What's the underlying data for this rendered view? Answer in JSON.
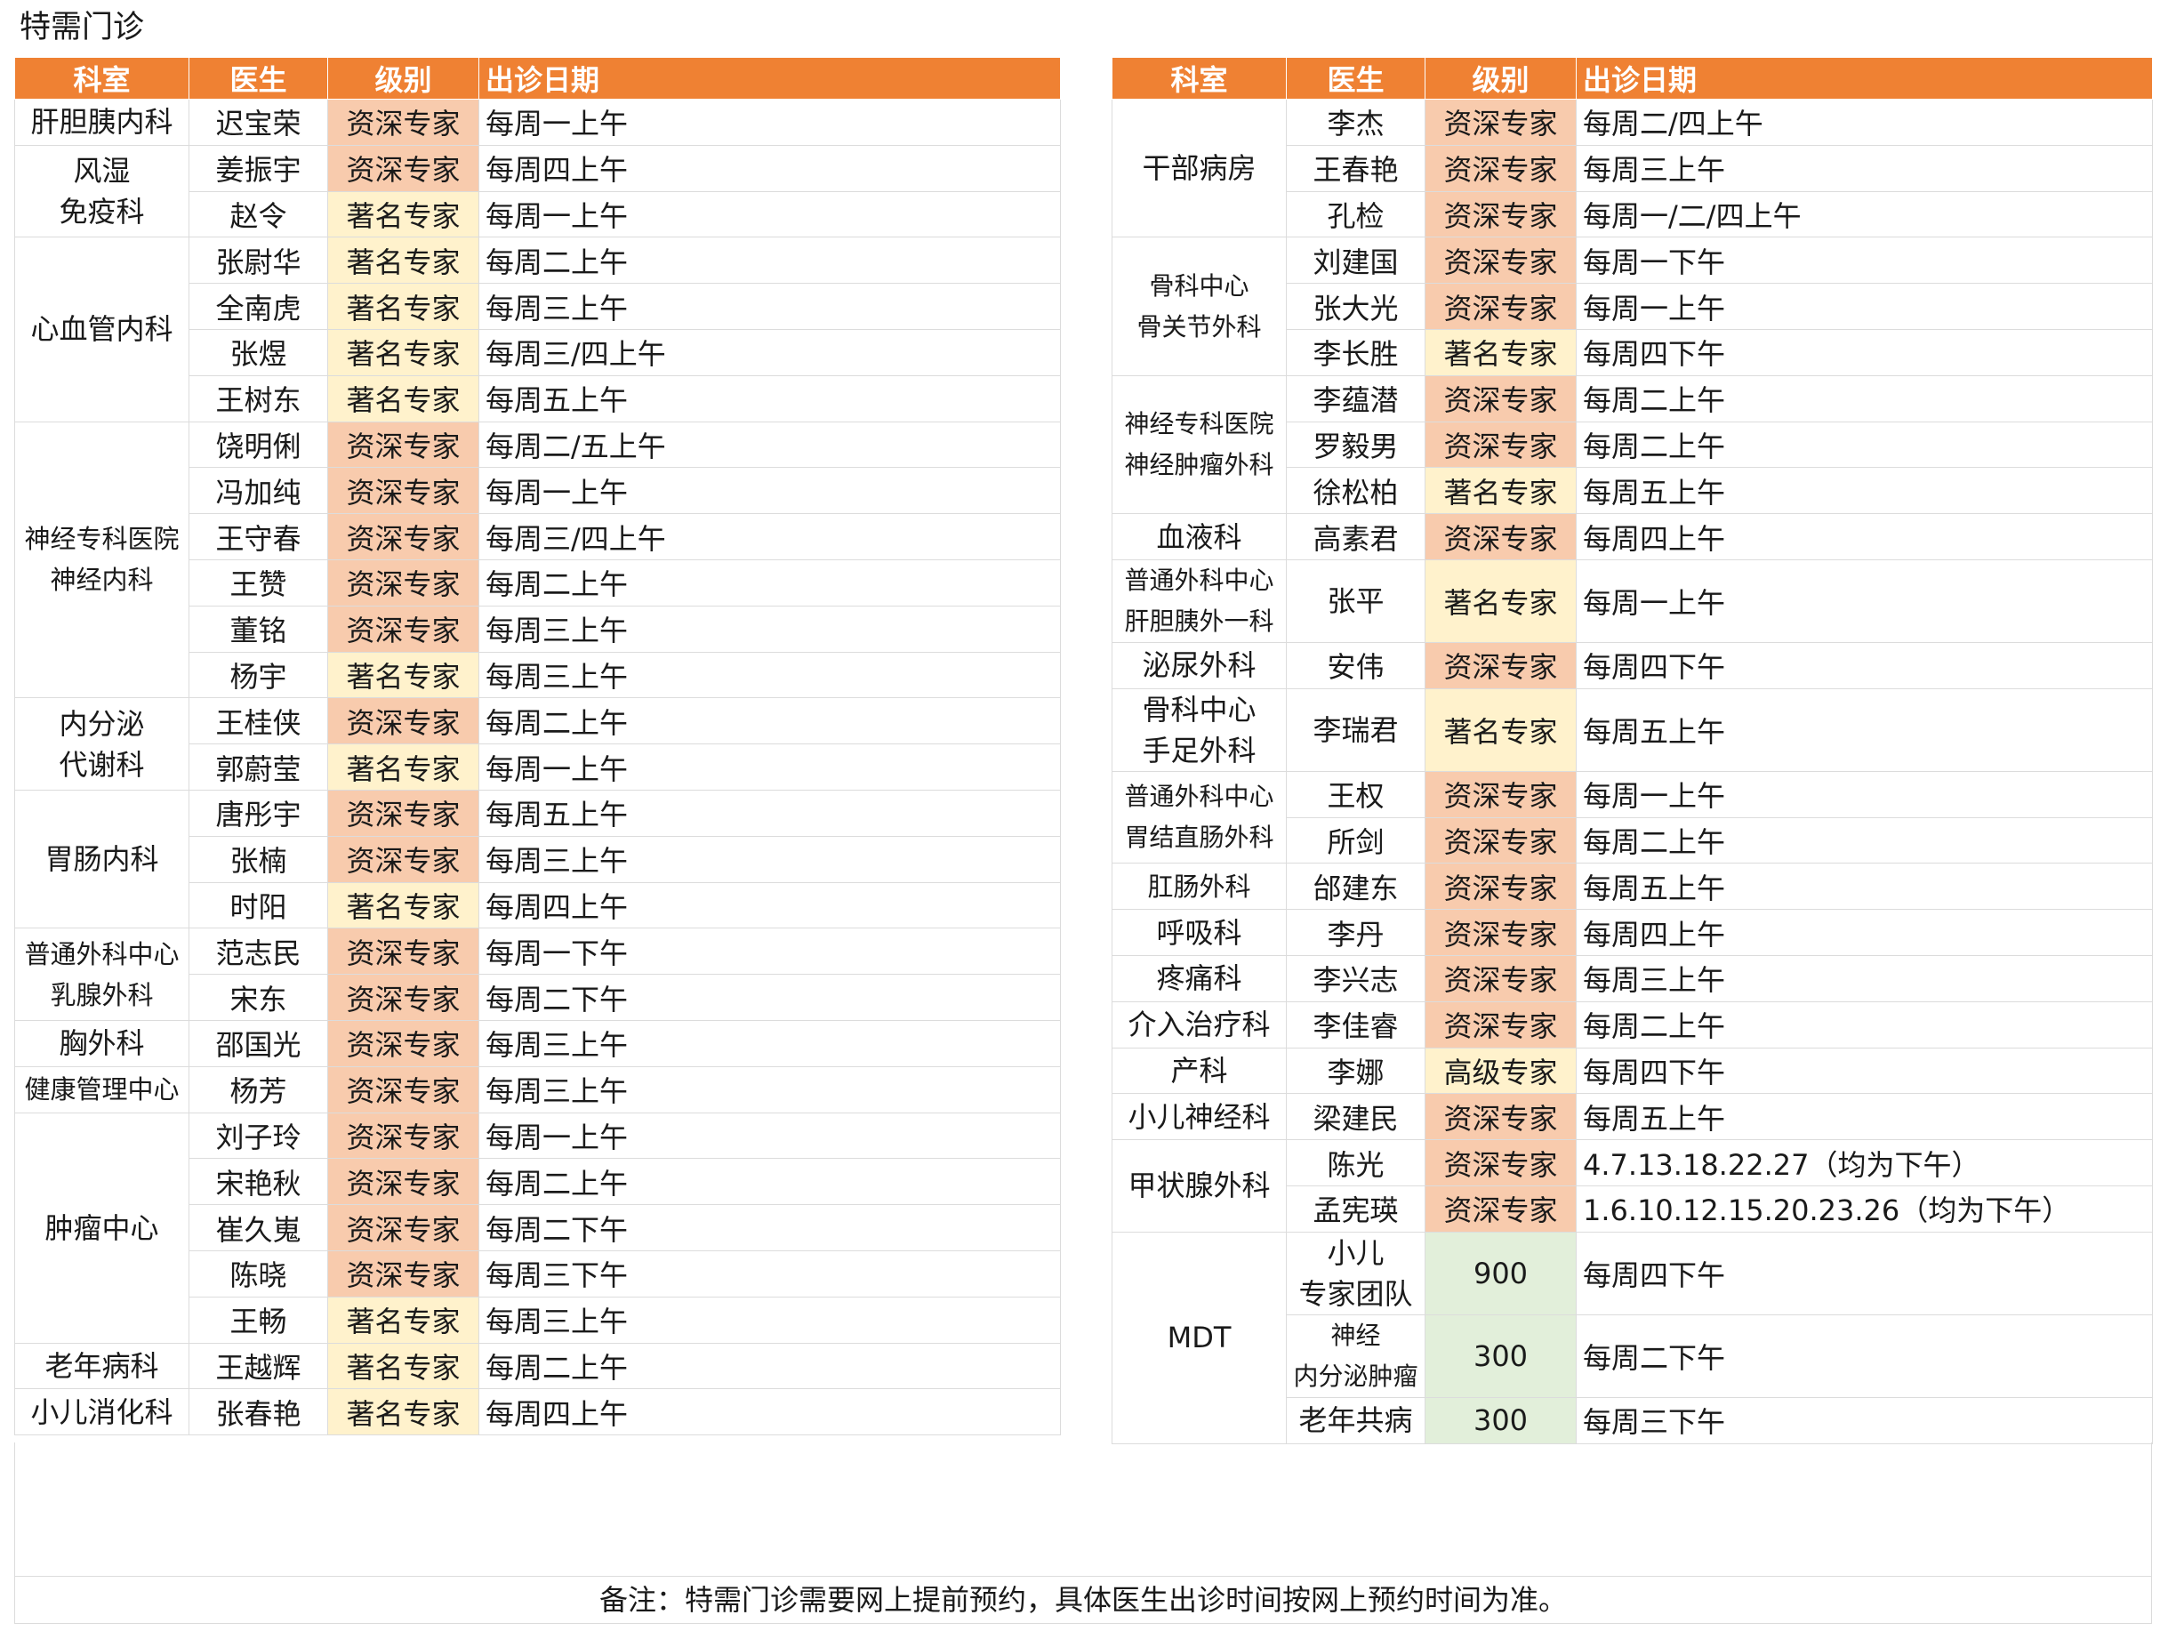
{
  "title": "特需门诊",
  "headers": [
    "科室",
    "医生",
    "级别",
    "出诊日期"
  ],
  "left_rows": [
    {
      "dept": "肝胆胰内科",
      "span": 1,
      "doctor": "迟宝荣",
      "level": "资深专家",
      "lvl": "zishen",
      "date": "每周一上午"
    },
    {
      "dept": "风湿\n免疫科",
      "span": 2,
      "doctor": "姜振宇",
      "level": "资深专家",
      "lvl": "zishen",
      "date": "每周四上午"
    },
    {
      "doctor": "赵令",
      "level": "著名专家",
      "lvl": "zhuming",
      "date": "每周一上午"
    },
    {
      "dept": "心血管内科",
      "span": 4,
      "doctor": "张尉华",
      "level": "著名专家",
      "lvl": "zhuming",
      "date": "每周二上午"
    },
    {
      "doctor": "全南虎",
      "level": "著名专家",
      "lvl": "zhuming",
      "date": "每周三上午"
    },
    {
      "doctor": "张煜",
      "level": "著名专家",
      "lvl": "zhuming",
      "date": "每周三/四上午"
    },
    {
      "doctor": "王树东",
      "level": "著名专家",
      "lvl": "zhuming",
      "date": "每周五上午"
    },
    {
      "dept": "神经专科医院\n神经内科",
      "span": 6,
      "sz": "sm",
      "doctor": "饶明俐",
      "level": "资深专家",
      "lvl": "zishen",
      "date": "每周二/五上午"
    },
    {
      "doctor": "冯加纯",
      "level": "资深专家",
      "lvl": "zishen",
      "date": "每周一上午"
    },
    {
      "doctor": "王守春",
      "level": "资深专家",
      "lvl": "zishen",
      "date": "每周三/四上午"
    },
    {
      "doctor": "王赞",
      "level": "资深专家",
      "lvl": "zishen",
      "date": "每周二上午"
    },
    {
      "doctor": "董铭",
      "level": "资深专家",
      "lvl": "zishen",
      "date": "每周三上午"
    },
    {
      "doctor": "杨宇",
      "level": "著名专家",
      "lvl": "zhuming",
      "date": "每周三上午"
    },
    {
      "dept": "内分泌\n代谢科",
      "span": 2,
      "doctor": "王桂侠",
      "level": "资深专家",
      "lvl": "zishen",
      "date": "每周二上午"
    },
    {
      "doctor": "郭蔚莹",
      "level": "著名专家",
      "lvl": "zhuming",
      "date": "每周一上午"
    },
    {
      "dept": "胃肠内科",
      "span": 3,
      "doctor": "唐彤宇",
      "level": "资深专家",
      "lvl": "zishen",
      "date": "每周五上午"
    },
    {
      "doctor": "张楠",
      "level": "资深专家",
      "lvl": "zishen",
      "date": "每周三上午"
    },
    {
      "doctor": "时阳",
      "level": "著名专家",
      "lvl": "zhuming",
      "date": "每周四上午"
    },
    {
      "dept": "普通外科中心\n乳腺外科",
      "span": 2,
      "sz": "sm",
      "doctor": "范志民",
      "level": "资深专家",
      "lvl": "zishen",
      "date": "每周一下午"
    },
    {
      "doctor": "宋东",
      "level": "资深专家",
      "lvl": "zishen",
      "date": "每周二下午"
    },
    {
      "dept": "胸外科",
      "span": 1,
      "doctor": "邵国光",
      "level": "资深专家",
      "lvl": "zishen",
      "date": "每周三上午"
    },
    {
      "dept": "健康管理中心",
      "span": 1,
      "sz": "sm",
      "doctor": "杨芳",
      "level": "资深专家",
      "lvl": "zishen",
      "date": "每周三上午"
    },
    {
      "dept": "肿瘤中心",
      "span": 5,
      "doctor": "刘子玲",
      "level": "资深专家",
      "lvl": "zishen",
      "date": "每周一上午"
    },
    {
      "doctor": "宋艳秋",
      "level": "资深专家",
      "lvl": "zishen",
      "date": "每周二上午"
    },
    {
      "doctor": "崔久嵬",
      "level": "资深专家",
      "lvl": "zishen",
      "date": "每周二下午"
    },
    {
      "doctor": "陈晓",
      "level": "资深专家",
      "lvl": "zishen",
      "date": "每周三下午"
    },
    {
      "doctor": "王畅",
      "level": "著名专家",
      "lvl": "zhuming",
      "date": "每周三上午"
    },
    {
      "dept": "老年病科",
      "span": 1,
      "doctor": "王越辉",
      "level": "著名专家",
      "lvl": "zhuming",
      "date": "每周二上午"
    },
    {
      "dept": "小儿消化科",
      "span": 1,
      "doctor": "张春艳",
      "level": "著名专家",
      "lvl": "zhuming",
      "date": "每周四上午"
    }
  ],
  "right_rows": [
    {
      "dept": "干部病房",
      "span": 3,
      "doctor": "李杰",
      "level": "资深专家",
      "lvl": "zishen",
      "date": "每周二/四上午"
    },
    {
      "doctor": "王春艳",
      "level": "资深专家",
      "lvl": "zishen",
      "date": "每周三上午"
    },
    {
      "doctor": "孔检",
      "level": "资深专家",
      "lvl": "zishen",
      "date": "每周一/二/四上午"
    },
    {
      "dept": "骨科中心\n骨关节外科",
      "span": 3,
      "sz": "xs",
      "doctor": "刘建国",
      "level": "资深专家",
      "lvl": "zishen",
      "date": "每周一下午"
    },
    {
      "doctor": "张大光",
      "level": "资深专家",
      "lvl": "zishen",
      "date": "每周一上午"
    },
    {
      "doctor": "李长胜",
      "level": "著名专家",
      "lvl": "zhuming",
      "date": "每周四下午"
    },
    {
      "dept": "神经专科医院\n神经肿瘤外科",
      "span": 3,
      "sz": "xs",
      "doctor": "李蕴潜",
      "level": "资深专家",
      "lvl": "zishen",
      "date": "每周二上午"
    },
    {
      "doctor": "罗毅男",
      "level": "资深专家",
      "lvl": "zishen",
      "date": "每周二上午"
    },
    {
      "doctor": "徐松柏",
      "level": "著名专家",
      "lvl": "zhuming",
      "date": "每周五上午"
    },
    {
      "dept": "血液科",
      "span": 1,
      "doctor": "高素君",
      "level": "资深专家",
      "lvl": "zishen",
      "date": "每周四上午"
    },
    {
      "dept": "普通外科中心\n肝胆胰外一科",
      "span": 1,
      "sz": "xs",
      "h": 2,
      "doctor": "张平",
      "level": "著名专家",
      "lvl": "zhuming",
      "date": "每周一上午"
    },
    {
      "dept": "泌尿外科",
      "span": 1,
      "doctor": "安伟",
      "level": "资深专家",
      "lvl": "zishen",
      "date": "每周四下午"
    },
    {
      "dept": "骨科中心\n手足外科",
      "span": 1,
      "h": 2,
      "doctor": "李瑞君",
      "level": "著名专家",
      "lvl": "zhuming",
      "date": "每周五上午"
    },
    {
      "dept": "普通外科中心\n胃结直肠外科",
      "span": 2,
      "sz": "xs",
      "doctor": "王权",
      "level": "资深专家",
      "lvl": "zishen",
      "date": "每周一上午"
    },
    {
      "doctor": "所剑",
      "level": "资深专家",
      "lvl": "zishen",
      "date": "每周二上午"
    },
    {
      "dept": "肛肠外科",
      "span": 1,
      "sz": "sm",
      "doctor": "邰建东",
      "level": "资深专家",
      "lvl": "zishen",
      "date": "每周五上午"
    },
    {
      "dept": "呼吸科",
      "span": 1,
      "doctor": "李丹",
      "level": "资深专家",
      "lvl": "zishen",
      "date": "每周四上午"
    },
    {
      "dept": "疼痛科",
      "span": 1,
      "doctor": "李兴志",
      "level": "资深专家",
      "lvl": "zishen",
      "date": "每周三上午"
    },
    {
      "dept": "介入治疗科",
      "span": 1,
      "doctor": "李佳睿",
      "level": "资深专家",
      "lvl": "zishen",
      "date": "每周二上午"
    },
    {
      "dept": "产科",
      "span": 1,
      "doctor": "李娜",
      "level": "高级专家",
      "lvl": "gaoji",
      "date": "每周四下午"
    },
    {
      "dept": "小儿神经科",
      "span": 1,
      "doctor": "梁建民",
      "level": "资深专家",
      "lvl": "zishen",
      "date": "每周五上午"
    },
    {
      "dept": "甲状腺外科",
      "span": 2,
      "doctor": "陈光",
      "level": "资深专家",
      "lvl": "zishen",
      "date": "4.7.13.18.22.27（均为下午）"
    },
    {
      "doctor": "孟宪瑛",
      "level": "资深专家",
      "lvl": "zishen",
      "date": "1.6.10.12.15.20.23.26（均为下午）"
    },
    {
      "dept": "MDT",
      "span": 3,
      "doctor": "小儿\n专家团队",
      "h": 2,
      "level": "900",
      "lvl": "green",
      "date": "每周四下午"
    },
    {
      "doctor": "神经\n内分泌肿瘤",
      "dsz": "xs",
      "h": 2,
      "level": "300",
      "lvl": "green",
      "date": "每周二下午"
    },
    {
      "doctor": "老年共病",
      "h": 2,
      "level": "300",
      "lvl": "green",
      "date": "每周三下午"
    }
  ],
  "footer_note": "备注：特需门诊需要网上提前预约，具体医生出诊时间按网上预约时间为准。"
}
